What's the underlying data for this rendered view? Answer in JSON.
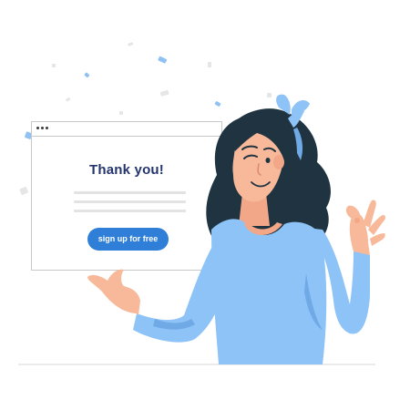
{
  "card": {
    "title": "Thank you!",
    "button_label": "sign up for free"
  },
  "colors": {
    "brand_blue": "#2f7fd8",
    "title_navy": "#24356e",
    "shirt_blue": "#8ec3f7",
    "hair": "#1f3440",
    "skin": "#f7b99a",
    "confetti": "#8fc2f2"
  }
}
